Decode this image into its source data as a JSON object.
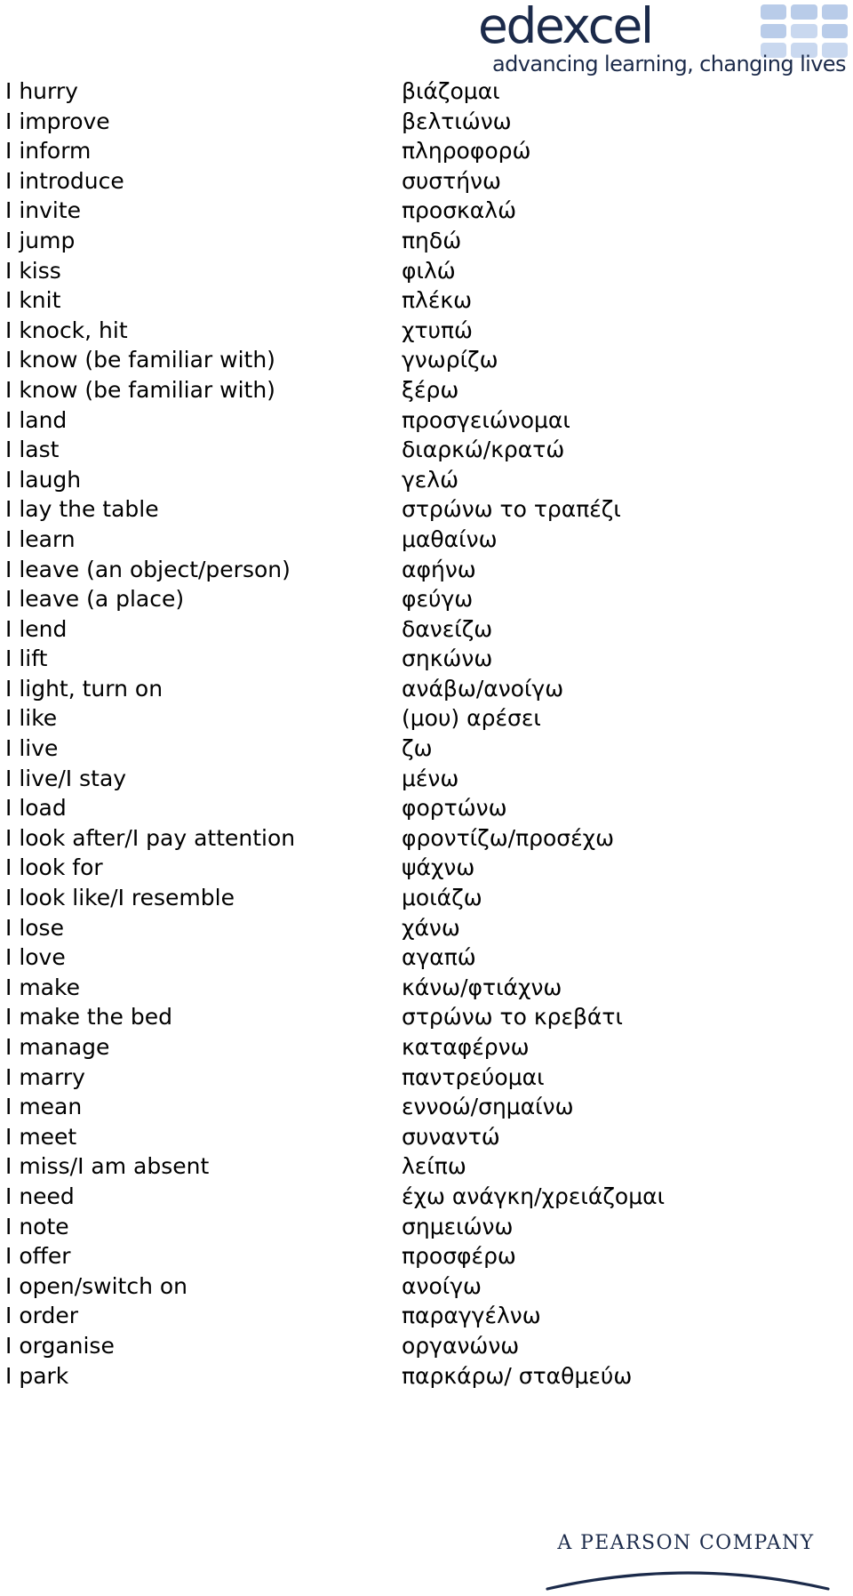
{
  "header": {
    "logo_wordmark": "edexcel",
    "logo_tagline": "advancing learning, changing lives"
  },
  "footer": {
    "pearson_text": "A PEARSON COMPANY"
  },
  "vocab": {
    "rows": [
      {
        "en": "I hurry",
        "el": "βιάζομαι"
      },
      {
        "en": "I improve",
        "el": "βελτιώνω"
      },
      {
        "en": "I inform",
        "el": "πληροφορώ"
      },
      {
        "en": "I introduce",
        "el": "συστήνω"
      },
      {
        "en": "I invite",
        "el": "προσκαλώ"
      },
      {
        "en": "I jump",
        "el": "πηδώ"
      },
      {
        "en": "I kiss",
        "el": "φιλώ"
      },
      {
        "en": "I knit",
        "el": "πλέκω"
      },
      {
        "en": "I knock, hit",
        "el": "χτυπώ"
      },
      {
        "en": "I know (be familiar with)",
        "el": "γνωρίζω"
      },
      {
        "en": "I know (be familiar with)",
        "el": "ξέρω"
      },
      {
        "en": "I land",
        "el": "προσγειώνομαι"
      },
      {
        "en": "I last",
        "el": "διαρκώ/κρατώ"
      },
      {
        "en": "I laugh",
        "el": "γελώ"
      },
      {
        "en": "I lay the table",
        "el": "στρώνω το τραπέζι"
      },
      {
        "en": "I learn",
        "el": "μαθαίνω"
      },
      {
        "en": "I leave (an object/person)",
        "el": "αφήνω"
      },
      {
        "en": "I leave (a place)",
        "el": "φεύγω"
      },
      {
        "en": "I lend",
        "el": "δανείζω"
      },
      {
        "en": "I lift",
        "el": "σηκώνω"
      },
      {
        "en": "I light, turn on",
        "el": "ανάβω/ανοίγω"
      },
      {
        "en": "I like",
        "el": "(μου) αρέσει"
      },
      {
        "en": "I live",
        "el": "ζω"
      },
      {
        "en": "I live/I stay",
        "el": "μένω"
      },
      {
        "en": "I load",
        "el": "φορτώνω"
      },
      {
        "en": "I look after/I pay attention",
        "el": "φροντίζω/προσέχω"
      },
      {
        "en": "I look for",
        "el": "ψάχνω"
      },
      {
        "en": "I look like/I resemble",
        "el": "μοιάζω"
      },
      {
        "en": "I lose",
        "el": "χάνω"
      },
      {
        "en": "I love",
        "el": "αγαπώ"
      },
      {
        "en": "I make",
        "el": "κάνω/φτιάχνω"
      },
      {
        "en": "I make the bed",
        "el": "στρώνω το κρεβάτι"
      },
      {
        "en": "I manage",
        "el": "καταφέρνω"
      },
      {
        "en": "I marry",
        "el": "παντρεύομαι"
      },
      {
        "en": "I mean",
        "el": "εννοώ/σημαίνω"
      },
      {
        "en": "I meet",
        "el": "συναντώ"
      },
      {
        "en": "I miss/I am absent",
        "el": "λείπω"
      },
      {
        "en": "I need",
        "el": "έχω ανάγκη/χρειάζομαι"
      },
      {
        "en": "I note",
        "el": "σημειώνω"
      },
      {
        "en": "I offer",
        "el": "προσφέρω"
      },
      {
        "en": "I open/switch on",
        "el": "ανοίγω"
      },
      {
        "en": "I order",
        "el": "παραγγέλνω"
      },
      {
        "en": "I organise",
        "el": "οργανώνω"
      },
      {
        "en": "I park",
        "el": "παρκάρω/ σταθμεύω"
      }
    ]
  }
}
